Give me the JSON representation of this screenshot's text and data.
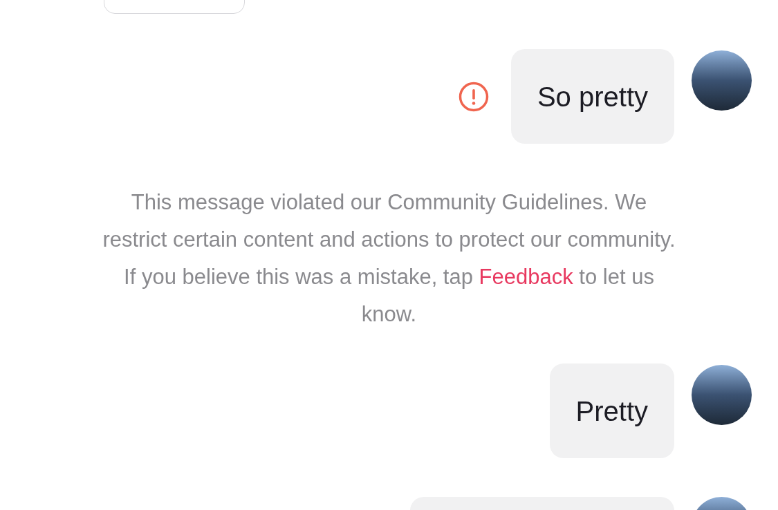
{
  "items": [
    {
      "kind": "message",
      "text": "So pretty",
      "failed": true
    },
    {
      "kind": "notice",
      "text": "This message violated our Community Guidelines. We restrict certain content and actions to protect our community. If you believe this was a mistake, tap ",
      "link": "Feedback",
      "after": " to let us know."
    },
    {
      "kind": "message",
      "text": "Pretty",
      "failed": false
    }
  ]
}
